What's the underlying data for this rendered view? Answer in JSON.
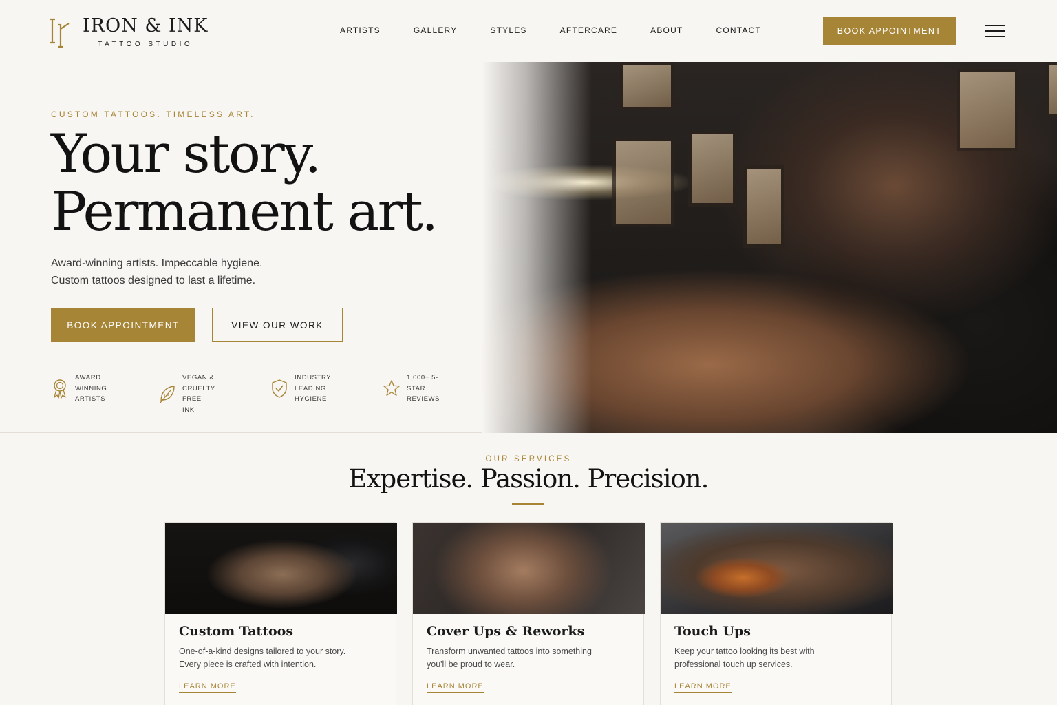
{
  "brand": {
    "name": "IRON & INK",
    "tagline": "TATTOO STUDIO",
    "accent_color": "#a78537"
  },
  "nav": {
    "items": [
      {
        "label": "ARTISTS"
      },
      {
        "label": "GALLERY"
      },
      {
        "label": "STYLES"
      },
      {
        "label": "AFTERCARE"
      },
      {
        "label": "ABOUT"
      },
      {
        "label": "CONTACT"
      }
    ],
    "book_button": "BOOK APPOINTMENT",
    "menu_icon": "hamburger-menu-icon"
  },
  "hero": {
    "eyebrow": "CUSTOM TATTOOS. TIMELESS ART.",
    "title_line1": "Your story.",
    "title_line2": "Permanent art.",
    "desc_line1": "Award-winning artists. Impeccable hygiene.",
    "desc_line2": "Custom tattoos designed to last a lifetime.",
    "primary_button": "BOOK APPOINTMENT",
    "secondary_button": "VIEW OUR WORK",
    "features": [
      {
        "icon": "award-ribbon-icon",
        "line1": "AWARD WINNING",
        "line2": "ARTISTS"
      },
      {
        "icon": "leaf-icon",
        "line1": "VEGAN & CRUELTY",
        "line2": "FREE INK"
      },
      {
        "icon": "shield-check-icon",
        "line1": "INDUSTRY LEADING",
        "line2": "HYGIENE"
      },
      {
        "icon": "star-icon",
        "line1": "1,000+ 5-STAR",
        "line2": "REVIEWS"
      }
    ]
  },
  "services": {
    "eyebrow": "OUR SERVICES",
    "title": "Expertise. Passion. Precision.",
    "cards": [
      {
        "title": "Custom Tattoos",
        "desc_line1": "One-of-a-kind designs tailored to your story.",
        "desc_line2": "Every piece is crafted with intention.",
        "link": "LEARN MORE"
      },
      {
        "title": "Cover Ups & Reworks",
        "desc_line1": "Transform unwanted tattoos into something",
        "desc_line2": "you'll be proud to wear.",
        "link": "LEARN MORE"
      },
      {
        "title": "Touch Ups",
        "desc_line1": "Keep your tattoo looking its best with",
        "desc_line2": "professional touch up services.",
        "link": "LEARN MORE"
      }
    ]
  }
}
